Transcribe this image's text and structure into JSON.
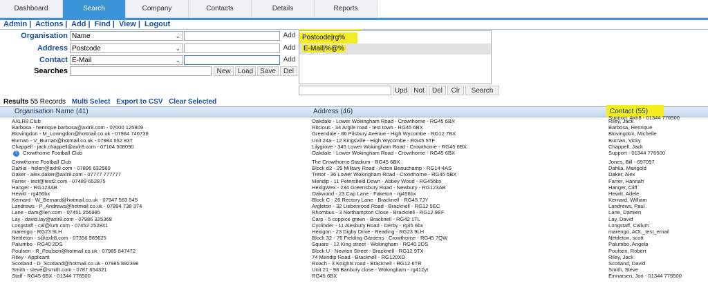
{
  "tabs": [
    "Dashboard",
    "Search",
    "Company",
    "Contacts",
    "Details",
    "Reports"
  ],
  "menu": [
    "Admin",
    "Actions",
    "Add",
    "Find",
    "View",
    "Logout"
  ],
  "form": {
    "organisation": {
      "label": "Organisation",
      "select": "Name",
      "value": "",
      "add": "Add"
    },
    "address": {
      "label": "Address",
      "select": "Postcode",
      "value": "",
      "add": "Add"
    },
    "contact": {
      "label": "Contact",
      "select": "E-Mail",
      "value": "",
      "add": "Add"
    },
    "searches": {
      "label": "Searches",
      "value": "",
      "buttons": [
        "New",
        "Load",
        "Save",
        "Del"
      ]
    }
  },
  "criteria_list": [
    "Postcode|rg%",
    "E-Mail|%@%"
  ],
  "list_buttons": [
    "Upd",
    "Not",
    "Del",
    "Clr",
    "Search"
  ],
  "results": {
    "label": "Results",
    "count": "55 Records",
    "links": [
      "Multi Select",
      "Export to CSV",
      "Clear Selected"
    ]
  },
  "columns": [
    "Organisation Name (41)",
    "Address (46)",
    "Contact (55)"
  ],
  "overflow_text": "Support, Axlr8 - 01344 776500",
  "rows": [
    [
      "AXLR8 Club",
      "Oakdale - Lower Wokingham Road - Crowthorne - RG45 6BX",
      "Riley, Jack"
    ],
    [
      "Barbosa - henrique.barbosa@axlr8.com - 07000 125809",
      "Ritcious - 34 Argile road - test town - RG45 6BX",
      "Barbosa, Henrique"
    ],
    [
      "Blovingdon - M_Lovingdon@hotmail.co.uk - 07984 746736",
      "Greendale - 86 Pilsbury Avenue - High Wycombe - RG12 7BX",
      "Blovingdon, Michelle"
    ],
    [
      "Burnan - V_Burnan@hotmail.co.uk - 07984 652 837",
      "Unit 24a - 12 Kingsville - High Wycombe - RG45 5TF",
      "Burnan, Vicky"
    ],
    [
      "Chappell - jack.chappell@axlr8.com - 07104 508090",
      "Lilygrove - 345 Lower Wokingham Road - Crowthorne - RG45 6BX",
      "Chappell, Jack"
    ],
    [
      "Crowthorne Football Club",
      "Oakdale - Lower Wokingham Road - Crowthorne - RG45 6BX",
      "Support - 01344 776500"
    ],
    [
      "Crowthorne Football Club",
      "The Crowthorne Stadium - RG45 6BX",
      "Jones, Bill - 697097"
    ],
    [
      "Dahlia - helen@axlr8.com - 07896 632569",
      "Block d2 - 25 Military Road - Acton Beauchamp - RG14 4AS",
      "Dahlia, Marigold"
    ],
    [
      "Daker - alex.daker@axlr8.com - 07777 777777",
      "Tretor - 36 Lower Wokingham Road - Crowthorne - RG45 6BX",
      "Daker, Alex"
    ],
    [
      "Farrer - test@test2.com - 07489 652875",
      "Mendip - 11 Petersfield Down - Abbey Wood - RG456bx",
      "Farrer, Hannah"
    ],
    [
      "Hanger - RG123AB",
      "HexigWex - 234 Greensbury Road - Newbury - RG123AB",
      "Hanger, Cliff"
    ],
    [
      "Hewitt - rg456bx",
      "Oakwood - 23 Cap Lane - Faketon - rg456bx",
      "Hewitt, Adele"
    ],
    [
      "Kernard - W_Bernard@hotmail.co.uk - 07947 563 545",
      "Block C - 26 Rectory Lane - Bracknell - RG45 7JY",
      "Kernard, William"
    ],
    [
      "Landrews - P_Andrews@hotmail.co.uk - 07894 738 374",
      "Argleton - 32 Liebenrood Road - Bracknell - RG12 5EC",
      "Landrews, Paul"
    ],
    [
      "Lane - dam@len.com - 07451 256985",
      "Rhombus - 3 Northampton Close - Bracknell - RG12 9EF",
      "Lane, Damien"
    ],
    [
      "Lay - david.lay@axlr8.com - 07986 325368",
      "Carp - 5 coppice green - Bracknell - RG42 1TL",
      "Lay, David"
    ],
    [
      "Longstaff - cal@lum.com - 07452 252841",
      "Cyclinder - 11 Alesbury Road - Derby - rg45 6bx",
      "Longstaff, Callum"
    ],
    [
      "marengo - RG23 9LH",
      "Hexigon - 23 Digby Drive - Reading - RG23 9LH",
      "marengo, AOL_test_email"
    ],
    [
      "Nettleton - s@axlr8.com - 07356 989625",
      "Block 32 - 76 Fielding Gardens - Crowthorne - RG45 7QW",
      "Nettleton, scott"
    ],
    [
      "Palumbo - RG40 2DS",
      "Square - 12 King street - Wokingham - RG40 2DS",
      "Palumbo, Angela"
    ],
    [
      "Poulsen - R_Poulsen@hotmail.co.uk - 07985 647472",
      "Block U - Newton Street - Bracknell - RG12 9TX",
      "Poulsen, Robert"
    ],
    [
      "Riley - Applicant",
      "74 Mendip Road - Bracknell - RG120XD",
      "Riley, Jack"
    ],
    [
      "Scotland - D_Scotland@hotmail.co.uk - 07985 892398",
      "Roach - 3 Knights road - Bracknell - RG12 6TR",
      "Scotland, David"
    ],
    [
      "Smith - steve@smith.com - 0787 654321",
      "Unit 21 - 98 Banbury close - Wokingham - rg412yt",
      "Smith, Steve"
    ],
    [
      "Staff - RG45 6BX - 01344 776500",
      "RG45 6BX",
      "Einnarsen, Jon - 01344 776500"
    ]
  ],
  "badge_icon": "help-icon",
  "colors": {
    "accent": "#3c94d8",
    "highlight": "#f4ee20",
    "link": "#1a4fa0"
  }
}
